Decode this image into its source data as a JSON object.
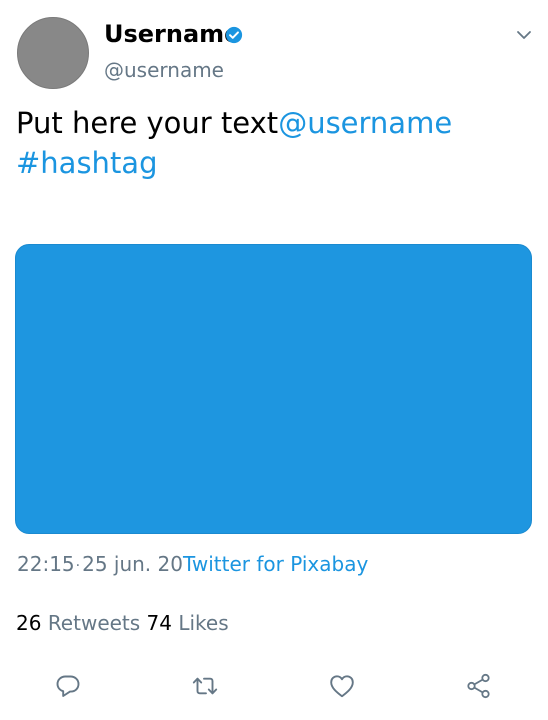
{
  "author": {
    "display_name": "Username",
    "handle": "@username",
    "verified": true
  },
  "tweet": {
    "text": "Put here your text",
    "mention": "@username",
    "hashtag": "#hashtag"
  },
  "meta": {
    "time": "22:15",
    "separator": "·",
    "date": "25 jun. 20",
    "source": "Twitter for Pixabay"
  },
  "stats": {
    "retweets_count": "26",
    "retweets_label": "Retweets",
    "likes_count": "74",
    "likes_label": "Likes"
  },
  "colors": {
    "accent": "#1b95e0",
    "media": "#1e96e0",
    "secondary_text": "#657786",
    "icon": "#657786",
    "avatar": "#888888"
  },
  "icons": [
    "verified-badge-icon",
    "chevron-down-icon",
    "reply-icon",
    "retweet-icon",
    "like-icon",
    "share-icon"
  ]
}
